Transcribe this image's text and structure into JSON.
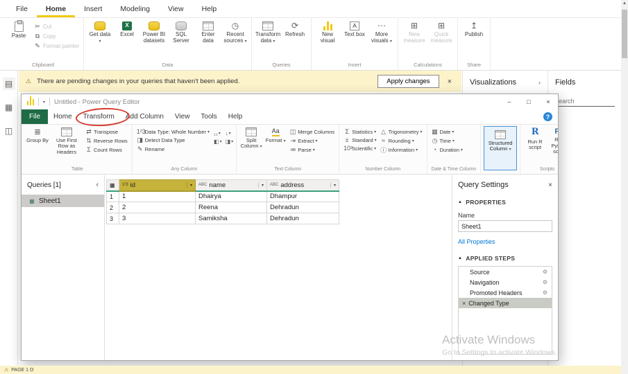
{
  "colors": {
    "accent": "#F2C811",
    "pq_file_green": "#1E6B46",
    "link_blue": "#0078D4",
    "selected_column_header": "#C5B33C",
    "notification_bg": "#FCF3CB",
    "header_underline": "#3BA07E",
    "structured_selection_border": "#4A90D9",
    "annotation_red": "#D43B2F"
  },
  "icons": {
    "caret": "▾",
    "chevron_right": "›",
    "chevron_left": "‹",
    "cut": "✂",
    "copy": "⧉",
    "format_painter": "✎",
    "refresh": "⟳",
    "more_dots": "⋯",
    "publish": "↥",
    "warning": "⚠",
    "close": "×",
    "minimize": "–",
    "maximize": "□",
    "help": "?",
    "transpose": "⇄",
    "reverse_rows": "⇅",
    "count_rows": "Σ",
    "datatype": "1²3",
    "detect": "◨",
    "rename": "✎",
    "sort": "₁₂",
    "fill_down": "↓",
    "pivot": "◧",
    "unpivot": "◨",
    "merge": "◫",
    "extract": "⇥",
    "parse": "≔",
    "statistics": "Σ",
    "standard": "±",
    "scientific": "10²",
    "trigonometry": "△",
    "rounding": "≈",
    "information": "ⓘ",
    "date": "▦",
    "time": "◷",
    "duration": "◔",
    "clock": "◷",
    "gear": "⚙",
    "delete": "×",
    "triangle_up": "▲",
    "grid_corner": "▦",
    "sheet": "▦",
    "scroll_up": "▲",
    "report_view": "▤",
    "data_view": "▦",
    "model_view": "◫",
    "r_glyph": "R",
    "py_glyph": "Py",
    "measure": "⊞",
    "format": "Aa",
    "group_by": "≣",
    "qat_caret": "▾"
  },
  "main": {
    "menu": [
      "File",
      "Home",
      "Insert",
      "Modeling",
      "View",
      "Help"
    ],
    "ribbon": {
      "clipboard": {
        "label": "Clipboard",
        "paste": "Paste",
        "cut": "Cut",
        "copy": "Copy",
        "format_painter": "Format painter"
      },
      "data": {
        "label": "Data",
        "get_data": "Get data",
        "excel": "Excel",
        "pbi_datasets": "Power BI datasets",
        "sql_server": "SQL Server",
        "enter_data": "Enter data",
        "recent_sources": "Recent sources"
      },
      "queries": {
        "label": "Queries",
        "transform_data": "Transform data",
        "refresh": "Refresh"
      },
      "insert": {
        "label": "Insert",
        "new_visual": "New visual",
        "text_box": "Text box",
        "more_visuals": "More visuals"
      },
      "calculations": {
        "label": "Calculations",
        "new_measure": "New measure",
        "quick_measure": "Quick measure"
      },
      "share": {
        "label": "Share",
        "publish": "Publish"
      }
    },
    "notification": {
      "text": "There are pending changes in your queries that haven't been applied.",
      "apply_button": "Apply changes"
    },
    "panels": {
      "visualizations": "Visualizations",
      "fields": "Fields",
      "search": "Search"
    },
    "bottom_bar": {
      "text": "PAGE 1 O"
    }
  },
  "pq": {
    "title": "Untitled - Power Query Editor",
    "menu": [
      "File",
      "Home",
      "Transform",
      "Add Column",
      "View",
      "Tools",
      "Help"
    ],
    "ribbon": {
      "table": {
        "label": "Table",
        "group_by": "Group By",
        "first_row_headers": "Use First Row as Headers",
        "transpose": "Transpose",
        "reverse_rows": "Reverse Rows",
        "count_rows": "Count Rows"
      },
      "any_column": {
        "label": "Any Column",
        "data_type": "Data Type: Whole Number",
        "detect": "Detect Data Type",
        "rename": "Rename"
      },
      "text_column": {
        "label": "Text Column",
        "split": "Split Column",
        "format": "Format",
        "merge": "Merge Columns",
        "extract": "Extract",
        "parse": "Parse"
      },
      "number_column": {
        "label": "Number Column",
        "statistics": "Statistics",
        "standard": "Standard",
        "scientific": "Scientific",
        "trigonometry": "Trigonometry",
        "rounding": "Rounding",
        "information": "Information"
      },
      "datetime_column": {
        "label": "Date & Time Column",
        "date": "Date",
        "time": "Time",
        "duration": "Duration"
      },
      "structured": {
        "label": "Structured Column"
      },
      "scripts": {
        "label": "Scripts",
        "run_r": "Run R script",
        "run_python": "Run Python script"
      }
    },
    "queries_panel": {
      "title": "Queries [1]",
      "items": [
        {
          "label": "Sheet1"
        }
      ]
    },
    "grid": {
      "columns": [
        {
          "type_icon": "1²3",
          "name": "id"
        },
        {
          "type_icon": "ABC",
          "name": "name"
        },
        {
          "type_icon": "ABC",
          "name": "address"
        }
      ],
      "rows": [
        {
          "num": "1",
          "id": "1",
          "name": "Dhairya",
          "address": "Dhampur"
        },
        {
          "num": "2",
          "id": "2",
          "name": "Reena",
          "address": "Dehradun"
        },
        {
          "num": "3",
          "id": "3",
          "name": "Samiksha",
          "address": "Dehradun"
        }
      ]
    },
    "settings": {
      "title": "Query Settings",
      "properties_header": "PROPERTIES",
      "name_label": "Name",
      "name_value": "Sheet1",
      "all_properties": "All Properties",
      "applied_steps_header": "APPLIED STEPS",
      "steps": [
        {
          "label": "Source"
        },
        {
          "label": "Navigation"
        },
        {
          "label": "Promoted Headers"
        },
        {
          "label": "Changed Type"
        }
      ]
    }
  },
  "watermark": {
    "line1": "Activate Windows",
    "line2": "Go to Settings to activate Windows."
  }
}
